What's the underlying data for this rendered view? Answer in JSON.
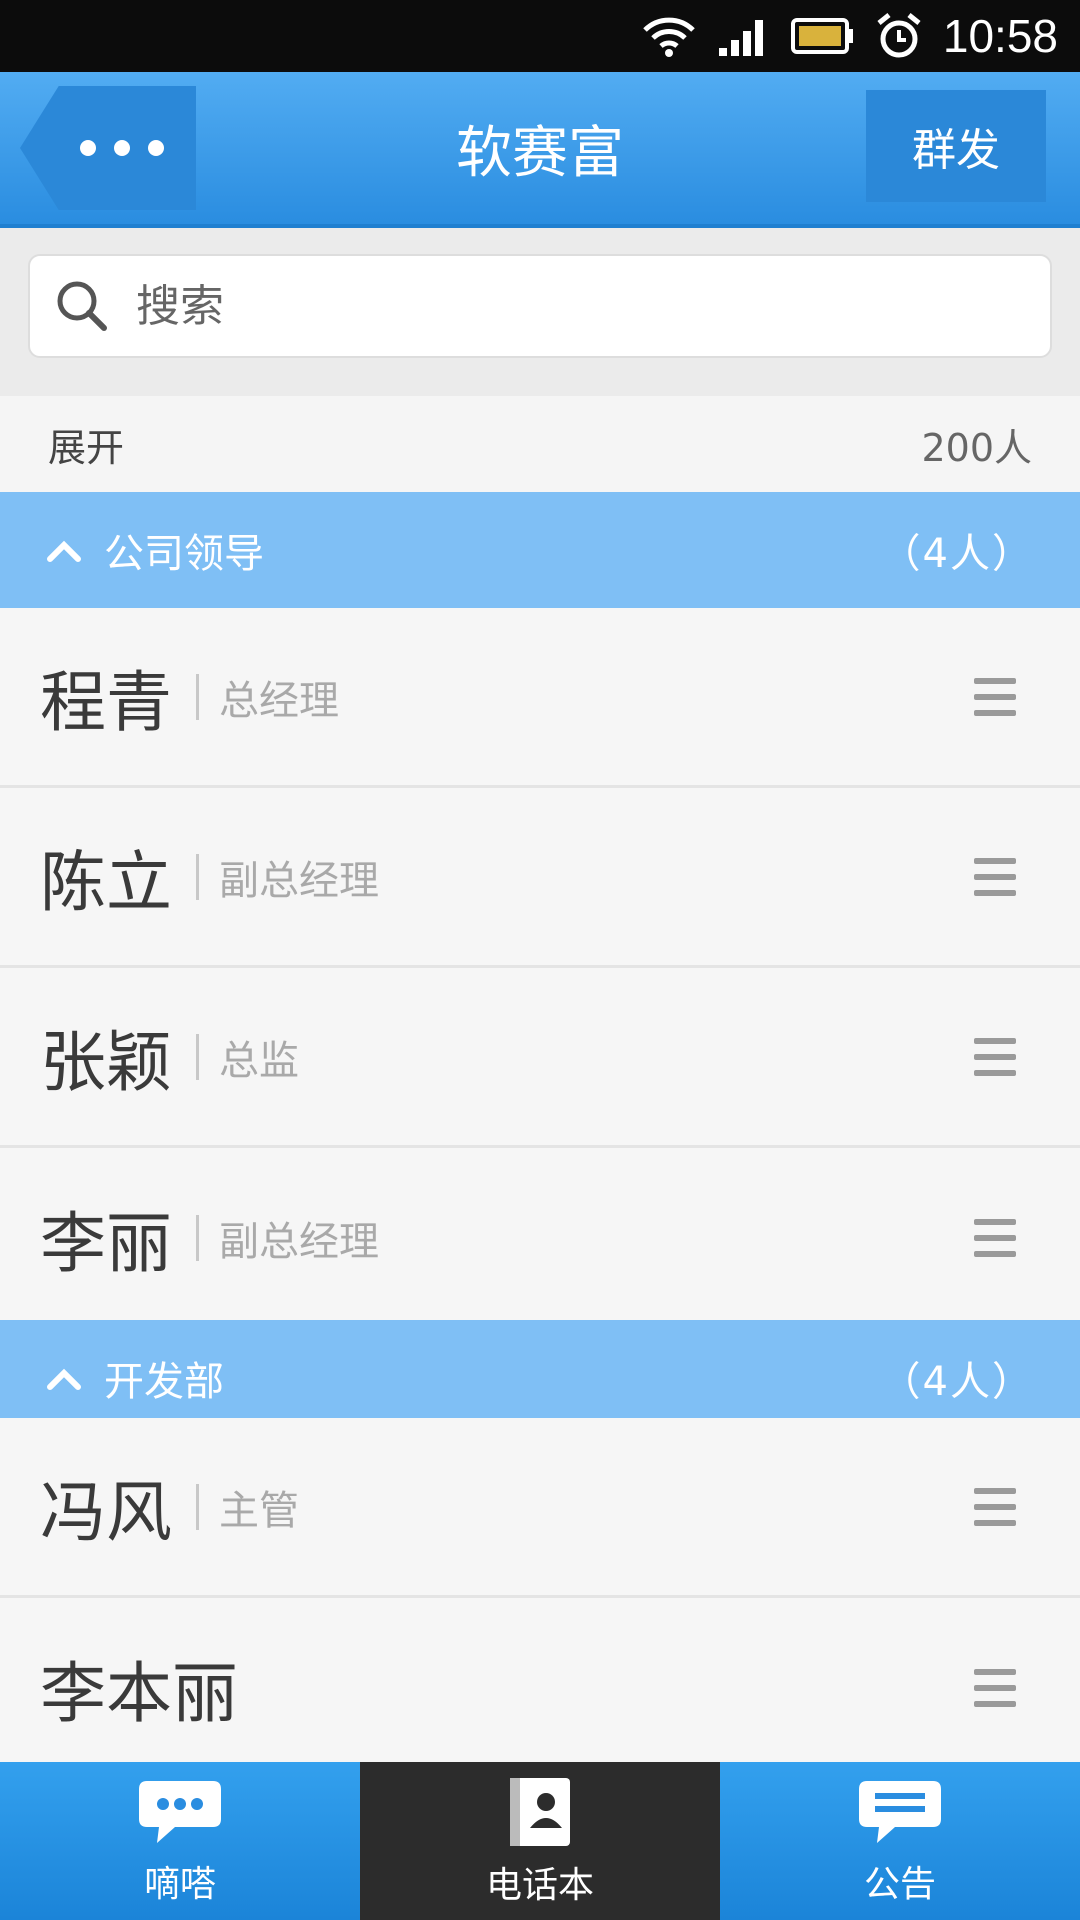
{
  "status_bar": {
    "time": "10:58",
    "icons": [
      "wifi-icon",
      "signal-icon",
      "battery-icon",
      "alarm-icon"
    ]
  },
  "header": {
    "title": "软赛富",
    "right_button": "群发",
    "left_button_icon": "more-dots-icon"
  },
  "search": {
    "placeholder": "搜索",
    "value": ""
  },
  "summary": {
    "expand_label": "展开",
    "total": "200人"
  },
  "groups": [
    {
      "name": "公司领导",
      "count": "（4人）",
      "contacts": [
        {
          "name": "程青",
          "title": "总经理"
        },
        {
          "name": "陈立",
          "title": "副总经理"
        },
        {
          "name": "张颖",
          "title": "总监"
        },
        {
          "name": "李丽",
          "title": "副总经理"
        }
      ]
    },
    {
      "name": "开发部",
      "count": "（4人）",
      "contacts": [
        {
          "name": "冯风",
          "title": "主管"
        },
        {
          "name": "李本丽",
          "title": ""
        }
      ]
    }
  ],
  "bottom_nav": [
    {
      "label": "嘀嗒",
      "icon": "chat-bubble-icon",
      "active": false
    },
    {
      "label": "电话本",
      "icon": "contacts-book-icon",
      "active": true
    },
    {
      "label": "公告",
      "icon": "announcement-icon",
      "active": false
    }
  ],
  "colors": {
    "header_blue": "#2a8de0",
    "group_header_blue": "#7fbff5",
    "nav_active": "#2c2c2c"
  }
}
